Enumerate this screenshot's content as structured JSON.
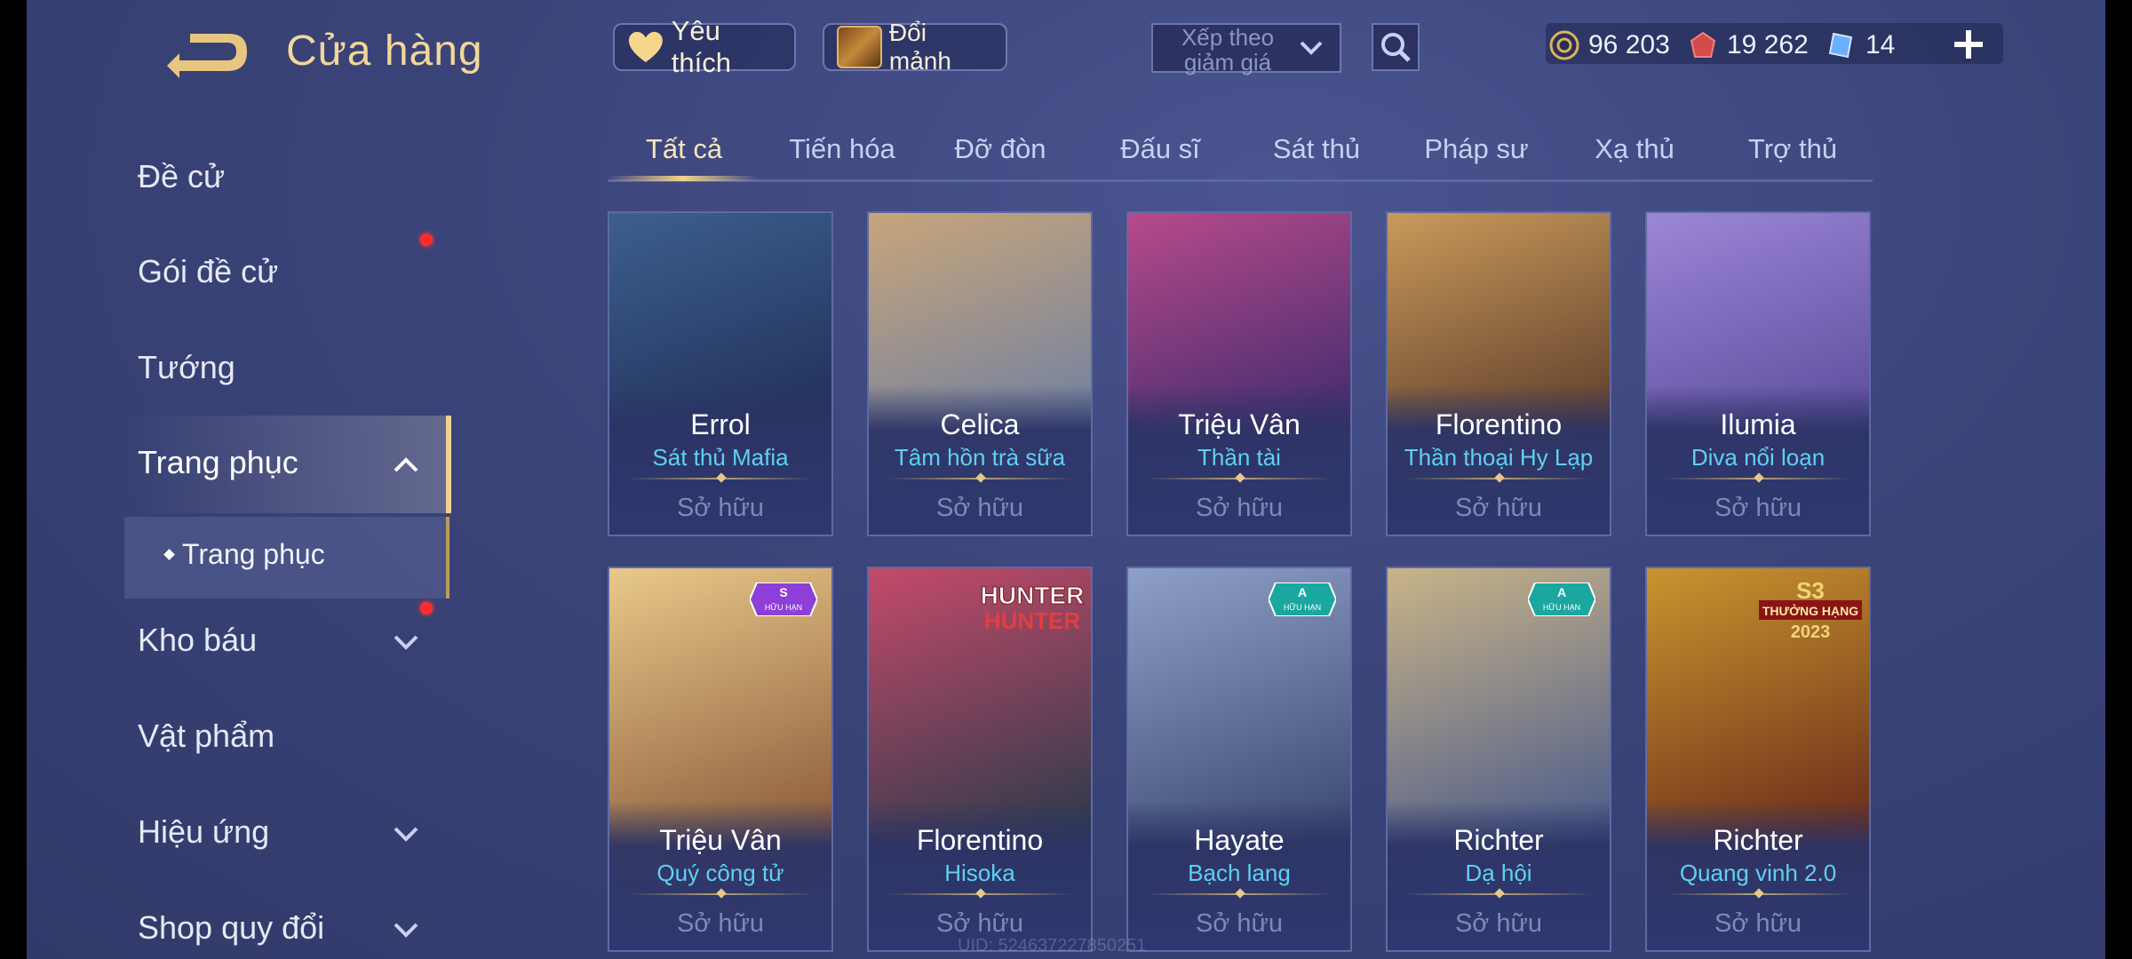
{
  "header": {
    "title": "Cửa hàng",
    "favorite_label": "Yêu thích",
    "shards_label": "Đổi mảnh",
    "sort_label": "Xếp theo giảm giá"
  },
  "currencies": [
    {
      "name": "gold",
      "value": "96 203",
      "color": "#d9b35c"
    },
    {
      "name": "ruby",
      "value": "19 262",
      "color": "#d44b4b"
    },
    {
      "name": "voucher",
      "value": "14",
      "color": "#6ab0ff"
    }
  ],
  "sidebar": {
    "items": [
      {
        "label": "Đề cử"
      },
      {
        "label": "Gói đề cử"
      },
      {
        "label": "Tướng"
      },
      {
        "label": "Trang phục"
      },
      {
        "label": "Trang phục"
      },
      {
        "label": "Kho báu"
      },
      {
        "label": "Vật phẩm"
      },
      {
        "label": "Hiệu ứng"
      },
      {
        "label": "Shop quy đổi"
      }
    ]
  },
  "tabs": [
    "Tất cả",
    "Tiến hóa",
    "Đỡ đòn",
    "Đấu sĩ",
    "Sát thủ",
    "Pháp sư",
    "Xạ thủ",
    "Trợ thủ"
  ],
  "cards": [
    {
      "hero": "Errol",
      "skin": "Sát thủ Mafia",
      "status": "Sở hữu",
      "palette": [
        "#3d5f8f",
        "#1f2d55"
      ]
    },
    {
      "hero": "Celica",
      "skin": "Tâm hồn trà sữa",
      "status": "Sở hữu",
      "palette": [
        "#c8a57a",
        "#6d7fa3"
      ]
    },
    {
      "hero": "Triệu Vân",
      "skin": "Thần tài",
      "status": "Sở hữu",
      "palette": [
        "#b74a8a",
        "#3b2a6d"
      ]
    },
    {
      "hero": "Florentino",
      "skin": "Thần thoại Hy Lạp",
      "status": "Sở hữu",
      "palette": [
        "#c99a5a",
        "#5a3a2a"
      ]
    },
    {
      "hero": "Ilumia",
      "skin": "Diva nổi loạn",
      "status": "Sở hữu",
      "palette": [
        "#9c86d8",
        "#5a4a9a"
      ]
    },
    {
      "hero": "Triệu Vân",
      "skin": "Quý công tử",
      "status": "Sở hữu",
      "palette": [
        "#e9c98a",
        "#8a5a3a"
      ],
      "badge": "S",
      "badge_sub": "HỮU HẠN",
      "badge_color": "#8d3fd8"
    },
    {
      "hero": "Florentino",
      "skin": "Hisoka",
      "status": "Sở hữu",
      "palette": [
        "#c44a6a",
        "#2a3a4a"
      ],
      "banner_top": "HUNTER",
      "banner_bottom": "HUNTER"
    },
    {
      "hero": "Hayate",
      "skin": "Bạch lang",
      "status": "Sở hữu",
      "palette": [
        "#8fa0c8",
        "#3a4870"
      ],
      "badge": "A",
      "badge_sub": "HỮU HẠN",
      "badge_color": "#1aa7a0"
    },
    {
      "hero": "Richter",
      "skin": "Dạ hội",
      "status": "Sở hữu",
      "palette": [
        "#c9b488",
        "#4a5a8a"
      ],
      "badge": "A",
      "badge_sub": "HỮU HẠN",
      "badge_color": "#1aa7a0"
    },
    {
      "hero": "Richter",
      "skin": "Quang vinh 2.0",
      "status": "Sở hữu",
      "palette": [
        "#c8952e",
        "#6a2a1a"
      ],
      "banner_top": "S3",
      "banner_mid": "THƯỞNG HẠNG",
      "banner_bottom": "2023"
    }
  ],
  "uid_text": "UID: 524637227850251"
}
